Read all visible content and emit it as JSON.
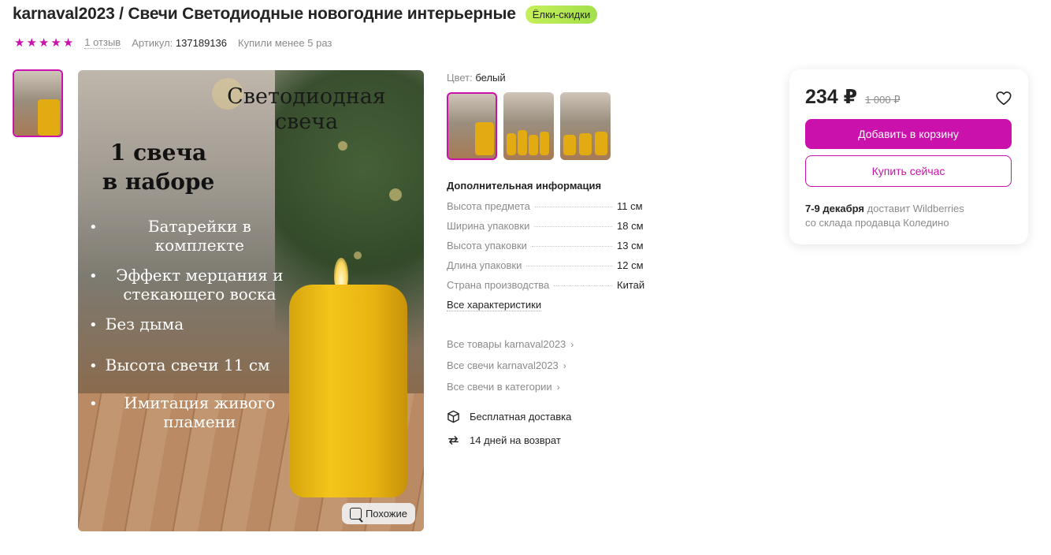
{
  "header": {
    "title": "karnaval2023 / Свечи Светодиодные новогодние интерьерные",
    "promo_badge": "Ёлки-скидки",
    "rating_stars": 5,
    "reviews": "1 отзыв",
    "article_label": "Артикул:",
    "article_value": "137189136",
    "bought": "Купили менее 5 раз"
  },
  "image": {
    "heading_line1": "Светодиодная",
    "heading_line2": "свеча",
    "sub_line1": "1 свеча",
    "sub_line2": "в наборе",
    "bullets": [
      {
        "line1": "Батарейки в",
        "line2": "комплекте"
      },
      {
        "line1": "Эффект мерцания и",
        "line2": "стекающего воска"
      },
      {
        "line1": "Без дыма",
        "line2": ""
      },
      {
        "line1": "Высота свечи 11 см",
        "line2": ""
      },
      {
        "line1": "Имитация живого",
        "line2": "пламени"
      }
    ],
    "similar_button": "Похожие"
  },
  "info": {
    "color_label": "Цвет:",
    "color_value": "белый",
    "additional_title": "Дополнительная информация",
    "characteristics": [
      {
        "name": "Высота предмета",
        "value": "11 см"
      },
      {
        "name": "Ширина упаковки",
        "value": "18 см"
      },
      {
        "name": "Высота упаковки",
        "value": "13 см"
      },
      {
        "name": "Длина упаковки",
        "value": "12 см"
      },
      {
        "name": "Страна производства",
        "value": "Китай"
      }
    ],
    "all_chars_link": "Все характеристики",
    "links": [
      "Все товары karnaval2023",
      "Все свечи karnaval2023",
      "Все свечи в категории"
    ],
    "perks": [
      {
        "icon": "box-icon",
        "text": "Бесплатная доставка"
      },
      {
        "icon": "return-icon",
        "text": "14 дней на возврат"
      }
    ]
  },
  "buy": {
    "price": "234 ₽",
    "old_price": "1 000 ₽",
    "add_to_cart": "Добавить в корзину",
    "buy_now": "Купить сейчас",
    "delivery_date": "7-9 декабря",
    "delivery_by": " доставит Wildberries",
    "delivery_from": "со склада продавца Коледино"
  },
  "colors": {
    "accent": "#cb11ab",
    "text": "#242424",
    "muted": "#8b8b8b"
  }
}
